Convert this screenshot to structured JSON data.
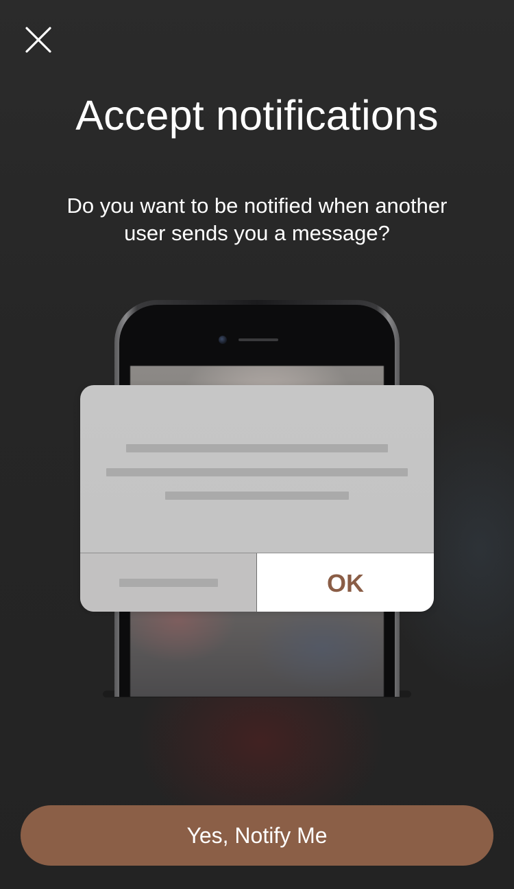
{
  "header": {
    "close_icon": "close-icon",
    "title": "Accept notifications"
  },
  "message": {
    "text": "Do you want to be notified when another user sends you a message?"
  },
  "illustration": {
    "device": "phone-illustration",
    "alert": {
      "ok_label": "OK",
      "ok_color": "#8a5d46"
    }
  },
  "cta": {
    "label": "Yes, Notify Me",
    "color": "#8b5f47"
  }
}
